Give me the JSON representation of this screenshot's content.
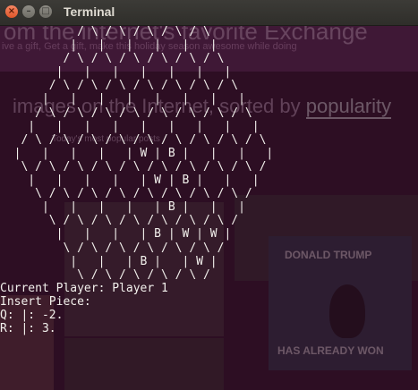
{
  "window": {
    "title": "Terminal",
    "buttons": {
      "close_glyph": "×",
      "minimize_glyph": "–",
      "maximize_glyph": "□"
    }
  },
  "background_page": {
    "heading": "om the internet's favorite Exchange",
    "subheading": "ive a gift, Get a gift, make this holiday season awesome while doing",
    "sort_text": "images on the Internet, sorted by",
    "sort_link": "popularity",
    "small_text": "Today's most popular posts",
    "meme_top": "DONALD TRUMP",
    "meme_bottom": "HAS ALREADY WON"
  },
  "terminal": {
    "board_lines": [
      "           / \\ / \\ / \\ / \\ / \\",
      "          |   |   |   |   |   |",
      "         / \\ / \\ / \\ / \\ / \\ / \\",
      "        |   |   |   |   |   |   |",
      "       / \\ / \\ / \\ / \\ / \\ / \\ / \\",
      "      |   |   |   |   |   |   |   |",
      "     / \\ / \\ / \\ / \\ / \\ / \\ / \\ / \\",
      "    |   |   |   |   |   |   |   |   |",
      "   / \\ / \\ / \\ / \\ / \\ / \\ / \\ / \\ / \\",
      "  |   |   |   |   | W | B |   |   |   |",
      "   \\ / \\ / \\ / \\ / \\ / \\ / \\ / \\ / \\ /",
      "    |   |   |   |   | W | B |   |   |",
      "     \\ / \\ / \\ / \\ / \\ / \\ / \\ / \\ /",
      "      |   |   |   |   | B |   |   |",
      "       \\ / \\ / \\ / \\ / \\ / \\ / \\ /",
      "        |   |   |   | B | W | W |",
      "         \\ / \\ / \\ / \\ / \\ / \\ /",
      "          |   |   | B |   | W |",
      "           \\ / \\ / \\ / \\ / \\ /"
    ],
    "status_lines": [
      "Current Player: Player 1",
      "Insert Piece:",
      "Q: |: -2.",
      "R: |: 3."
    ]
  }
}
